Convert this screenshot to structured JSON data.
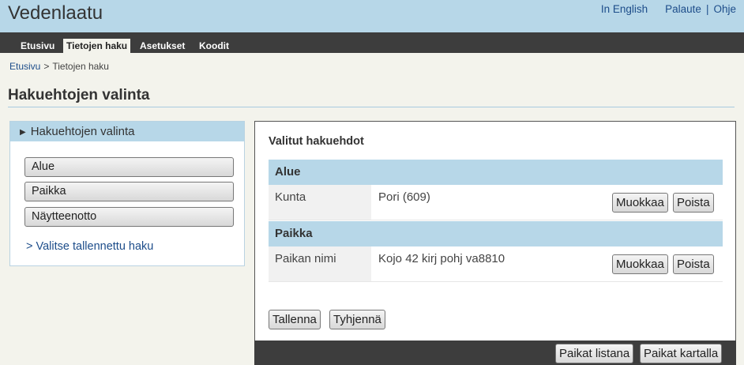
{
  "app": {
    "title": "Vedenlaatu"
  },
  "toplinks": {
    "english": "In English",
    "feedback": "Palaute",
    "separator": "|",
    "help": "Ohje"
  },
  "nav": {
    "tabs": [
      "Etusivu",
      "Tietojen haku",
      "Asetukset",
      "Koodit"
    ],
    "active_tab": "Tietojen haku"
  },
  "breadcrumb": {
    "home": "Etusivu",
    "separator": ">",
    "current": "Tietojen haku"
  },
  "page": {
    "title": "Hakuehtojen valinta"
  },
  "left_panel": {
    "header": "Hakuehtojen valinta",
    "buttons": [
      "Alue",
      "Paikka",
      "Näytteenotto"
    ],
    "saved_search_link": "> Valitse tallennettu haku"
  },
  "selected": {
    "title": "Valitut hakuehdot",
    "sections": [
      {
        "name": "Alue",
        "rows": [
          {
            "label": "Kunta",
            "value": "Pori (609)"
          }
        ]
      },
      {
        "name": "Paikka",
        "rows": [
          {
            "label": "Paikan nimi",
            "value": "Kojo 42 kirj pohj va8810"
          }
        ]
      }
    ],
    "edit_label": "Muokkaa",
    "remove_label": "Poista",
    "save_label": "Tallenna",
    "clear_label": "Tyhjennä"
  },
  "footer": {
    "list_label": "Paikat listana",
    "map_label": "Paikat kartalla"
  },
  "colors": {
    "header_bg": "#b7d7e8",
    "nav_bg": "#3d3d3d",
    "link": "#1d4d8a",
    "page_bg": "#f3f3ec"
  }
}
